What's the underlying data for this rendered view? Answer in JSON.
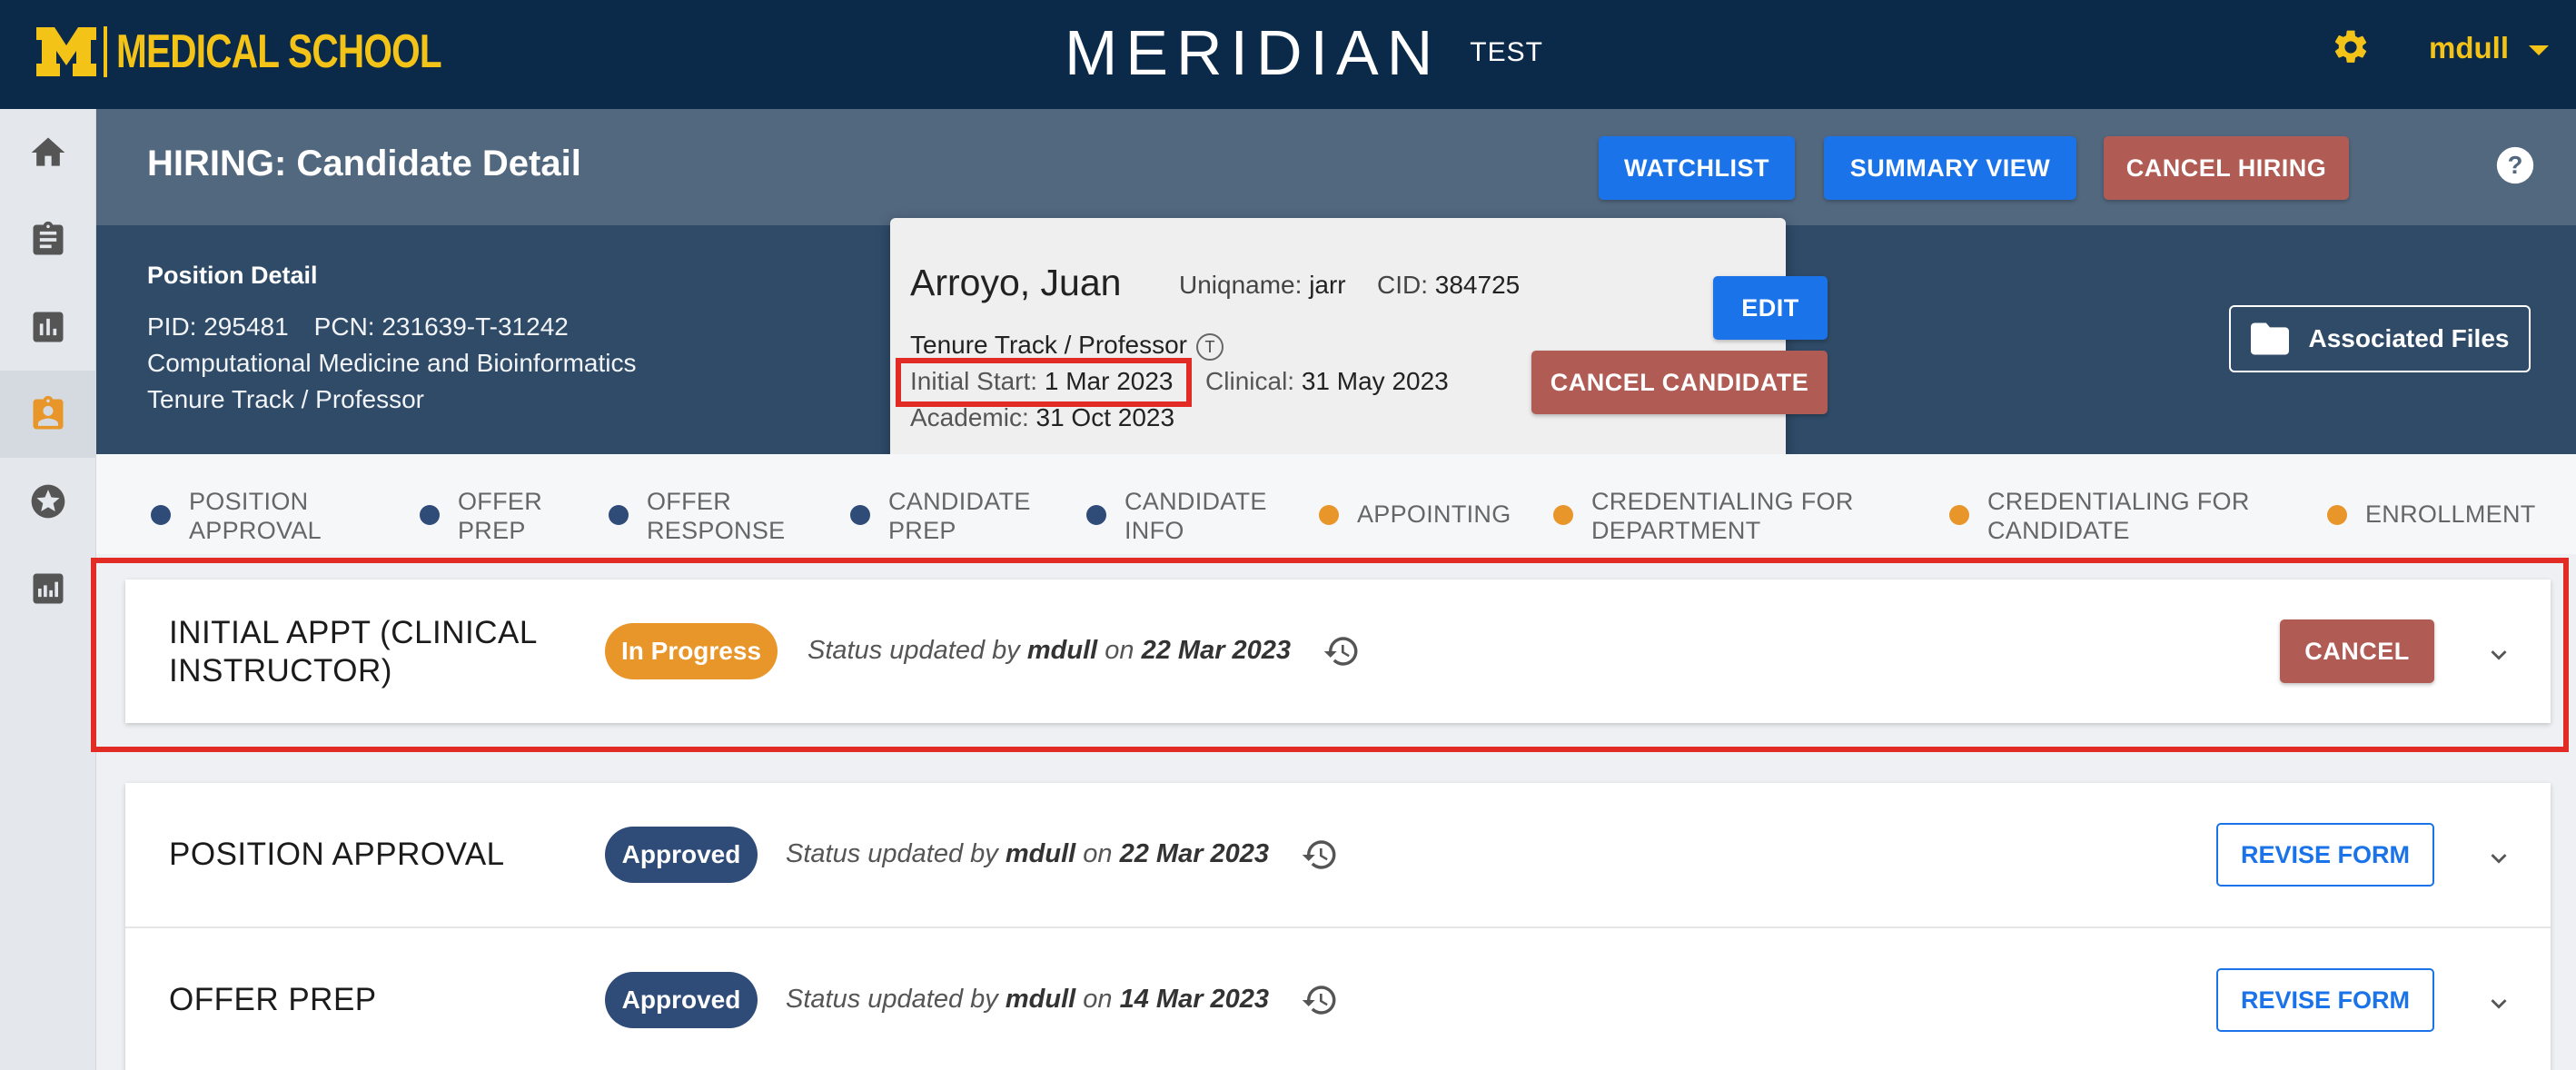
{
  "brand": {
    "text": "MEDICAL SCHOOL",
    "color": "#f3c318"
  },
  "app": {
    "logo": "MERIDIAN",
    "env": "TEST"
  },
  "user": {
    "name": "mdull"
  },
  "header": {
    "title": "HIRING: Candidate Detail",
    "buttons": {
      "watchlist": "WATCHLIST",
      "summary": "SUMMARY VIEW",
      "cancel_hiring": "CANCEL HIRING"
    }
  },
  "position": {
    "label": "Position Detail",
    "pid": "PID: 295481",
    "pcn": "PCN: 231639-T-31242",
    "department": "Computational Medicine and Bioinformatics",
    "track": "Tenure Track / Professor",
    "assoc_files": "Associated Files"
  },
  "candidate": {
    "name": "Arroyo, Juan",
    "uniqname_label": "Uniqname:",
    "uniqname": "jarr",
    "cid_label": "CID:",
    "cid": "384725",
    "track": "Tenure Track / Professor",
    "track_badge": "T",
    "initial_start_label": "Initial Start:",
    "initial_start": "1 Mar 2023",
    "clinical_label": "Clinical:",
    "clinical": "31 May 2023",
    "academic_label": "Academic:",
    "academic": "31 Oct 2023",
    "edit": "EDIT",
    "cancel_candidate": "CANCEL CANDIDATE"
  },
  "steps": [
    {
      "label": "POSITION\nAPPROVAL",
      "status": "complete"
    },
    {
      "label": "OFFER\nPREP",
      "status": "complete"
    },
    {
      "label": "OFFER\nRESPONSE",
      "status": "complete"
    },
    {
      "label": "CANDIDATE\nPREP",
      "status": "complete"
    },
    {
      "label": "CANDIDATE\nINFO",
      "status": "complete"
    },
    {
      "label": "APPOINTING",
      "status": "pending"
    },
    {
      "label": "CREDENTIALING FOR\nDEPARTMENT",
      "status": "pending"
    },
    {
      "label": "CREDENTIALING FOR\nCANDIDATE",
      "status": "pending"
    },
    {
      "label": "ENROLLMENT",
      "status": "pending"
    }
  ],
  "cards": [
    {
      "title": "INITIAL APPT (CLINICAL\nINSTRUCTOR)",
      "status": "In Progress",
      "updated_prefix": "Status updated by",
      "by": "mdull",
      "on": "on",
      "date": "22 Mar 2023",
      "action": "CANCEL"
    },
    {
      "title": "POSITION APPROVAL",
      "status": "Approved",
      "updated_prefix": "Status updated by",
      "by": "mdull",
      "on": "on",
      "date": "22 Mar 2023",
      "action": "REVISE FORM"
    },
    {
      "title": "OFFER PREP",
      "status": "Approved",
      "updated_prefix": "Status updated by",
      "by": "mdull",
      "on": "on",
      "date": "14 Mar 2023",
      "action": "REVISE FORM"
    }
  ],
  "colors": {
    "navy": "#0b2a4a",
    "accent_blue": "#1a73e8",
    "danger": "#b15b55",
    "in_progress": "#e8962a",
    "approved": "#2f4b78",
    "highlight": "#e12b24"
  }
}
